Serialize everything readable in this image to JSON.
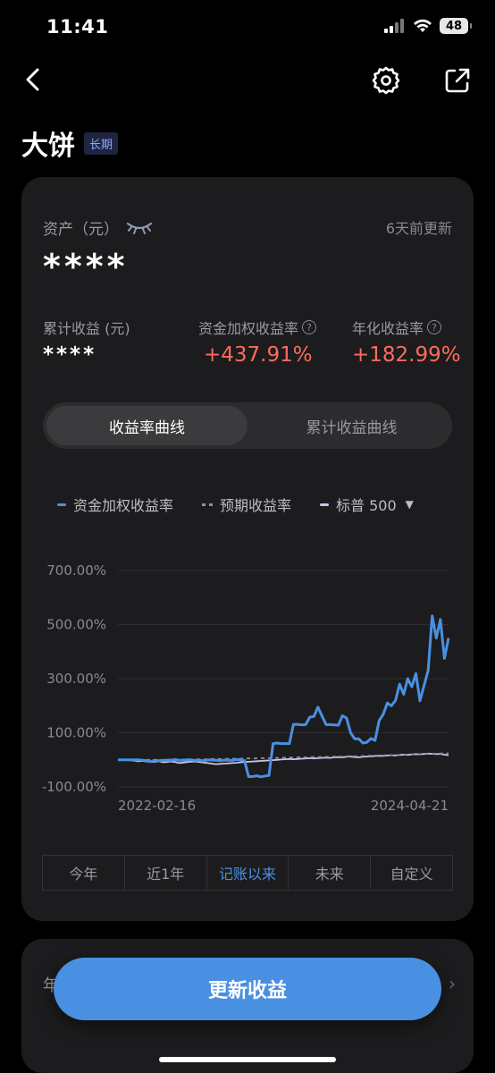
{
  "status": {
    "time": "11:41",
    "battery": "48"
  },
  "page": {
    "title": "大饼",
    "tag": "长期"
  },
  "asset": {
    "label": "资产（元）",
    "value": "****",
    "updated": "6天前更新"
  },
  "metrics": [
    {
      "label": "累计收益 (元)",
      "value": "****"
    },
    {
      "label": "资金加权收益率",
      "value": "+437.91%"
    },
    {
      "label": "年化收益率",
      "value": "+182.99%"
    }
  ],
  "tabs": [
    "收益率曲线",
    "累计收益曲线"
  ],
  "legend": [
    {
      "name": "资金加权收益率",
      "color": "#4a90e2"
    },
    {
      "name": "预期收益率",
      "color": "#8f8f9a"
    },
    {
      "name": "标普 500",
      "color": "#c9c3ee"
    }
  ],
  "chart_data": {
    "type": "line",
    "y_ticks": [
      "700.00%",
      "500.00%",
      "300.00%",
      "100.00%",
      "-100.00%"
    ],
    "x_ticks": [
      "2022-02-16",
      "2024-04-21"
    ],
    "ylim": [
      -100,
      700
    ],
    "grid": true,
    "series": [
      {
        "name": "资金加权收益率",
        "color": "#4a90e2",
        "values": [
          0,
          0,
          0,
          0,
          0,
          0,
          -1,
          -3,
          -7,
          -1,
          -3,
          -2,
          -1,
          -2,
          1,
          -2,
          -1,
          0,
          0,
          -2,
          -1,
          -4,
          0,
          -1,
          -1,
          -3,
          -1,
          -1,
          -2,
          1,
          0,
          -2,
          -62,
          -62,
          -59,
          -63,
          -60,
          -58,
          60,
          62,
          60,
          60,
          60,
          131,
          131,
          129,
          130,
          158,
          160,
          195,
          162,
          130,
          130,
          129,
          128,
          163,
          155,
          100,
          78,
          78,
          62,
          65,
          79,
          72,
          145,
          168,
          210,
          200,
          219,
          280,
          242,
          300,
          270,
          319,
          218,
          275,
          330,
          532,
          450,
          519,
          375,
          450
        ]
      },
      {
        "name": "预期收益率",
        "color": "#8f8f9a",
        "values": [
          0,
          0,
          0,
          0,
          0,
          0,
          0,
          0,
          0,
          0,
          0,
          0,
          0,
          1,
          1,
          1,
          1,
          1,
          1,
          2,
          2,
          2,
          2,
          3,
          3,
          3,
          3,
          4,
          4,
          4,
          4,
          5,
          5,
          5,
          5,
          6,
          6,
          6,
          7,
          7,
          7,
          8,
          8,
          8,
          9,
          9,
          9,
          10,
          10,
          10,
          11,
          11,
          11,
          12,
          12,
          12,
          13,
          13,
          13,
          14,
          14,
          15,
          15,
          16,
          16,
          16,
          17,
          17,
          18,
          18,
          19,
          19,
          20,
          20,
          21,
          21,
          22,
          22,
          23,
          23,
          24,
          24
        ]
      },
      {
        "name": "标普 500",
        "color": "#c9c3ee",
        "values": [
          0,
          0,
          0,
          -2,
          -3,
          -5,
          -4,
          -6,
          -8,
          -7,
          -5,
          -9,
          -8,
          -6,
          -8,
          -12,
          -10,
          -8,
          -7,
          -6,
          -8,
          -10,
          -12,
          -14,
          -16,
          -15,
          -14,
          -13,
          -12,
          -11,
          -9,
          -8,
          -7,
          -6,
          -5,
          -4,
          -3,
          -2,
          -1,
          0,
          1,
          2,
          3,
          2,
          3,
          4,
          5,
          6,
          5,
          6,
          7,
          8,
          7,
          9,
          10,
          9,
          11,
          12,
          10,
          9,
          11,
          12,
          13,
          14,
          15,
          14,
          16,
          17,
          16,
          18,
          19,
          18,
          20,
          21,
          20,
          22,
          23,
          22,
          21,
          22,
          19,
          17
        ]
      }
    ]
  },
  "ranges": [
    "今年",
    "近1年",
    "记账以来",
    "未来",
    "自定义"
  ],
  "active_range": 2,
  "card2": {
    "peek": "年"
  },
  "update_button": "更新收益"
}
